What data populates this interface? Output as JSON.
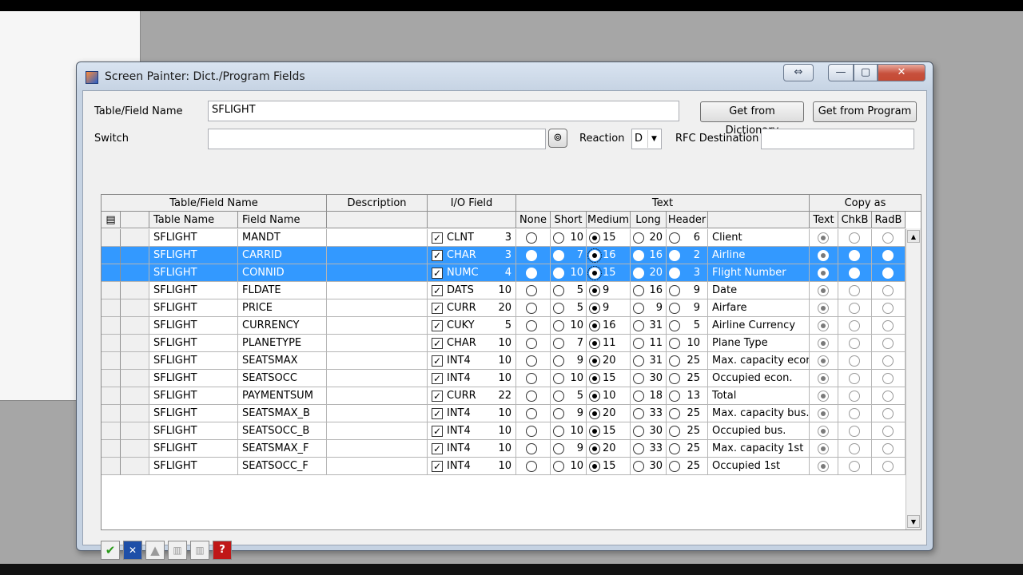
{
  "window": {
    "title": "Screen Painter: Dict./Program Fields",
    "controls": {
      "resize": "⇔",
      "minimize": "—",
      "maximize": "▢",
      "close": "✕"
    }
  },
  "form": {
    "table_field_label": "Table/Field Name",
    "table_field_value": "SFLIGHT",
    "get_dictionary": "Get from Dictionary",
    "get_program": "Get from Program",
    "switch_label": "Switch",
    "switch_value": "",
    "reaction_label": "Reaction",
    "reaction_value": "D",
    "rfc_label": "RFC Destination",
    "rfc_value": ""
  },
  "grid": {
    "groups": [
      "Table/Field Name",
      "Description",
      "I/O Field",
      "Text",
      "Copy as"
    ],
    "columns": [
      "Table Name",
      "Field Name",
      "None",
      "Short",
      "Medium",
      "Long",
      "Header",
      "Text",
      "ChkB",
      "RadB"
    ],
    "rows": [
      {
        "table": "SFLIGHT",
        "field": "MANDT",
        "type": "CLNT",
        "len": "3",
        "short": "10",
        "medium": "15",
        "long": "20",
        "header": "6",
        "text": "Client",
        "sel": false
      },
      {
        "table": "SFLIGHT",
        "field": "CARRID",
        "type": "CHAR",
        "len": "3",
        "short": "7",
        "medium": "16",
        "long": "16",
        "header": "2",
        "text": "Airline",
        "sel": true
      },
      {
        "table": "SFLIGHT",
        "field": "CONNID",
        "type": "NUMC",
        "len": "4",
        "short": "10",
        "medium": "15",
        "long": "20",
        "header": "3",
        "text": "Flight Number",
        "sel": true
      },
      {
        "table": "SFLIGHT",
        "field": "FLDATE",
        "type": "DATS",
        "len": "10",
        "short": "5",
        "medium": "9",
        "long": "16",
        "header": "9",
        "text": "Date",
        "sel": false
      },
      {
        "table": "SFLIGHT",
        "field": "PRICE",
        "type": "CURR",
        "len": "20",
        "short": "5",
        "medium": "9",
        "long": "9",
        "header": "9",
        "text": "Airfare",
        "sel": false
      },
      {
        "table": "SFLIGHT",
        "field": "CURRENCY",
        "type": "CUKY",
        "len": "5",
        "short": "10",
        "medium": "16",
        "long": "31",
        "header": "5",
        "text": "Airline Currency",
        "sel": false
      },
      {
        "table": "SFLIGHT",
        "field": "PLANETYPE",
        "type": "CHAR",
        "len": "10",
        "short": "7",
        "medium": "11",
        "long": "11",
        "header": "10",
        "text": "Plane Type",
        "sel": false
      },
      {
        "table": "SFLIGHT",
        "field": "SEATSMAX",
        "type": "INT4",
        "len": "10",
        "short": "9",
        "medium": "20",
        "long": "31",
        "header": "25",
        "text": "Max. capacity econ",
        "sel": false
      },
      {
        "table": "SFLIGHT",
        "field": "SEATSOCC",
        "type": "INT4",
        "len": "10",
        "short": "10",
        "medium": "15",
        "long": "30",
        "header": "25",
        "text": "Occupied econ.",
        "sel": false
      },
      {
        "table": "SFLIGHT",
        "field": "PAYMENTSUM",
        "type": "CURR",
        "len": "22",
        "short": "5",
        "medium": "10",
        "long": "18",
        "header": "13",
        "text": "Total",
        "sel": false
      },
      {
        "table": "SFLIGHT",
        "field": "SEATSMAX_B",
        "type": "INT4",
        "len": "10",
        "short": "9",
        "medium": "20",
        "long": "33",
        "header": "25",
        "text": "Max. capacity bus.",
        "sel": false
      },
      {
        "table": "SFLIGHT",
        "field": "SEATSOCC_B",
        "type": "INT4",
        "len": "10",
        "short": "10",
        "medium": "15",
        "long": "30",
        "header": "25",
        "text": "Occupied bus.",
        "sel": false
      },
      {
        "table": "SFLIGHT",
        "field": "SEATSMAX_F",
        "type": "INT4",
        "len": "10",
        "short": "9",
        "medium": "20",
        "long": "33",
        "header": "25",
        "text": "Max. capacity 1st",
        "sel": false
      },
      {
        "table": "SFLIGHT",
        "field": "SEATSOCC_F",
        "type": "INT4",
        "len": "10",
        "short": "10",
        "medium": "15",
        "long": "30",
        "header": "25",
        "text": "Occupied 1st",
        "sel": false
      }
    ]
  },
  "footer_icons": [
    "check-icon",
    "cancel-icon",
    "upload-icon",
    "save-local-icon",
    "save-icon",
    "help-icon"
  ],
  "colors": {
    "selection": "#3399ff",
    "confirm": "#2a9a1a",
    "cancel": "#1e4fa8",
    "help": "#c01818"
  }
}
